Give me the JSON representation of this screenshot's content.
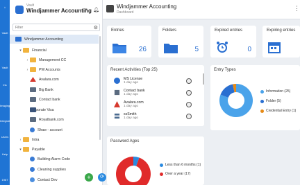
{
  "rail": {
    "items": [
      "Vault",
      "Vault",
      "Ins",
      "Imaging",
      "Integration",
      "Users",
      "Help",
      "1967"
    ]
  },
  "vault": {
    "small_label": "Vault",
    "title": "Windjammer Accounting",
    "filter_placeholder": "Filter",
    "tree": [
      {
        "label": "Windjammer Accounting",
        "type": "root"
      },
      {
        "label": "Financial",
        "type": "folder"
      },
      {
        "label": "Management CC",
        "type": "folder"
      },
      {
        "label": "PW Accounts",
        "type": "folder"
      },
      {
        "label": "Avalara.com",
        "type": "web-logo"
      },
      {
        "label": "Big Bank",
        "type": "bank"
      },
      {
        "label": "Contact bank",
        "type": "bank"
      },
      {
        "label": "Corporate Visa",
        "type": "card"
      },
      {
        "label": "Royalbank.com",
        "type": "bank"
      },
      {
        "label": "Shaw - account",
        "type": "web"
      },
      {
        "label": "Intra",
        "type": "folder"
      },
      {
        "label": "Payable",
        "type": "folder"
      },
      {
        "label": "Building Alarm Code",
        "type": "web"
      },
      {
        "label": "Cleaning supplies",
        "type": "web"
      },
      {
        "label": "Contact Dev",
        "type": "user"
      }
    ]
  },
  "main": {
    "title": "Windjammer Accounting",
    "subtitle": "Dashboard",
    "cards": [
      {
        "label": "Entries",
        "value": "26"
      },
      {
        "label": "Folders",
        "value": "5"
      },
      {
        "label": "Expired entries",
        "value": "0"
      },
      {
        "label": "Expiring entries",
        "value": ""
      }
    ],
    "recent": {
      "title": "Recent Activities (Top 25)",
      "items": [
        {
          "title": "MS License",
          "time": "1 day ago"
        },
        {
          "title": "Contact bank",
          "time": "1 day ago"
        },
        {
          "title": "Avalara.com",
          "time": "1 day ago"
        },
        {
          "title": "ssSmith",
          "time": "1 day ago"
        }
      ]
    },
    "entry_types": {
      "title": "Entry Types",
      "legend": [
        "Information (25)",
        "Folder (5)",
        "Credential Entry (1)"
      ]
    },
    "password_ages": {
      "title": "Password Ages",
      "legend": [
        "Less than 6 months (1)",
        "Over a year (17)"
      ]
    }
  },
  "colors": {
    "accent": "#2a6fd1",
    "entry_info": "#4aa3ea",
    "entry_folder": "#2a6fd1",
    "entry_cred": "#e68a17",
    "age_less6": "#2a8ae0",
    "age_over_year": "#e02a2a",
    "add": "#3aa84a"
  },
  "chart_data": [
    {
      "type": "pie",
      "title": "Entry Types",
      "categories": [
        "Information",
        "Folder",
        "Credential Entry"
      ],
      "values": [
        25,
        5,
        1
      ]
    },
    {
      "type": "pie",
      "title": "Password Ages",
      "categories": [
        "Less than 6 months",
        "Over a year"
      ],
      "values": [
        1,
        17
      ]
    }
  ]
}
